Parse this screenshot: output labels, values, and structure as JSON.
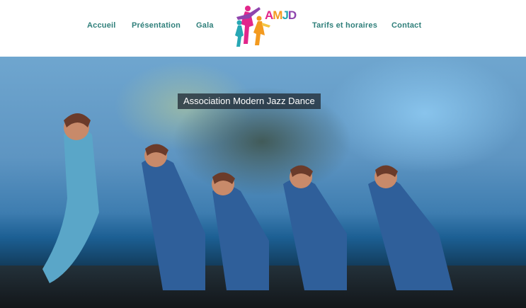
{
  "nav": {
    "items": [
      "Accueil",
      "Présentation",
      "Gala",
      "Tarifs et horaires",
      "Contact"
    ]
  },
  "logo": {
    "text": "AMJD"
  },
  "hero": {
    "title": "Association Modern Jazz Dance"
  },
  "colors": {
    "nav": "#2f7f7a",
    "logo_pink": "#e2268b",
    "logo_orange": "#f39a1f",
    "logo_teal": "#27a7b4"
  }
}
